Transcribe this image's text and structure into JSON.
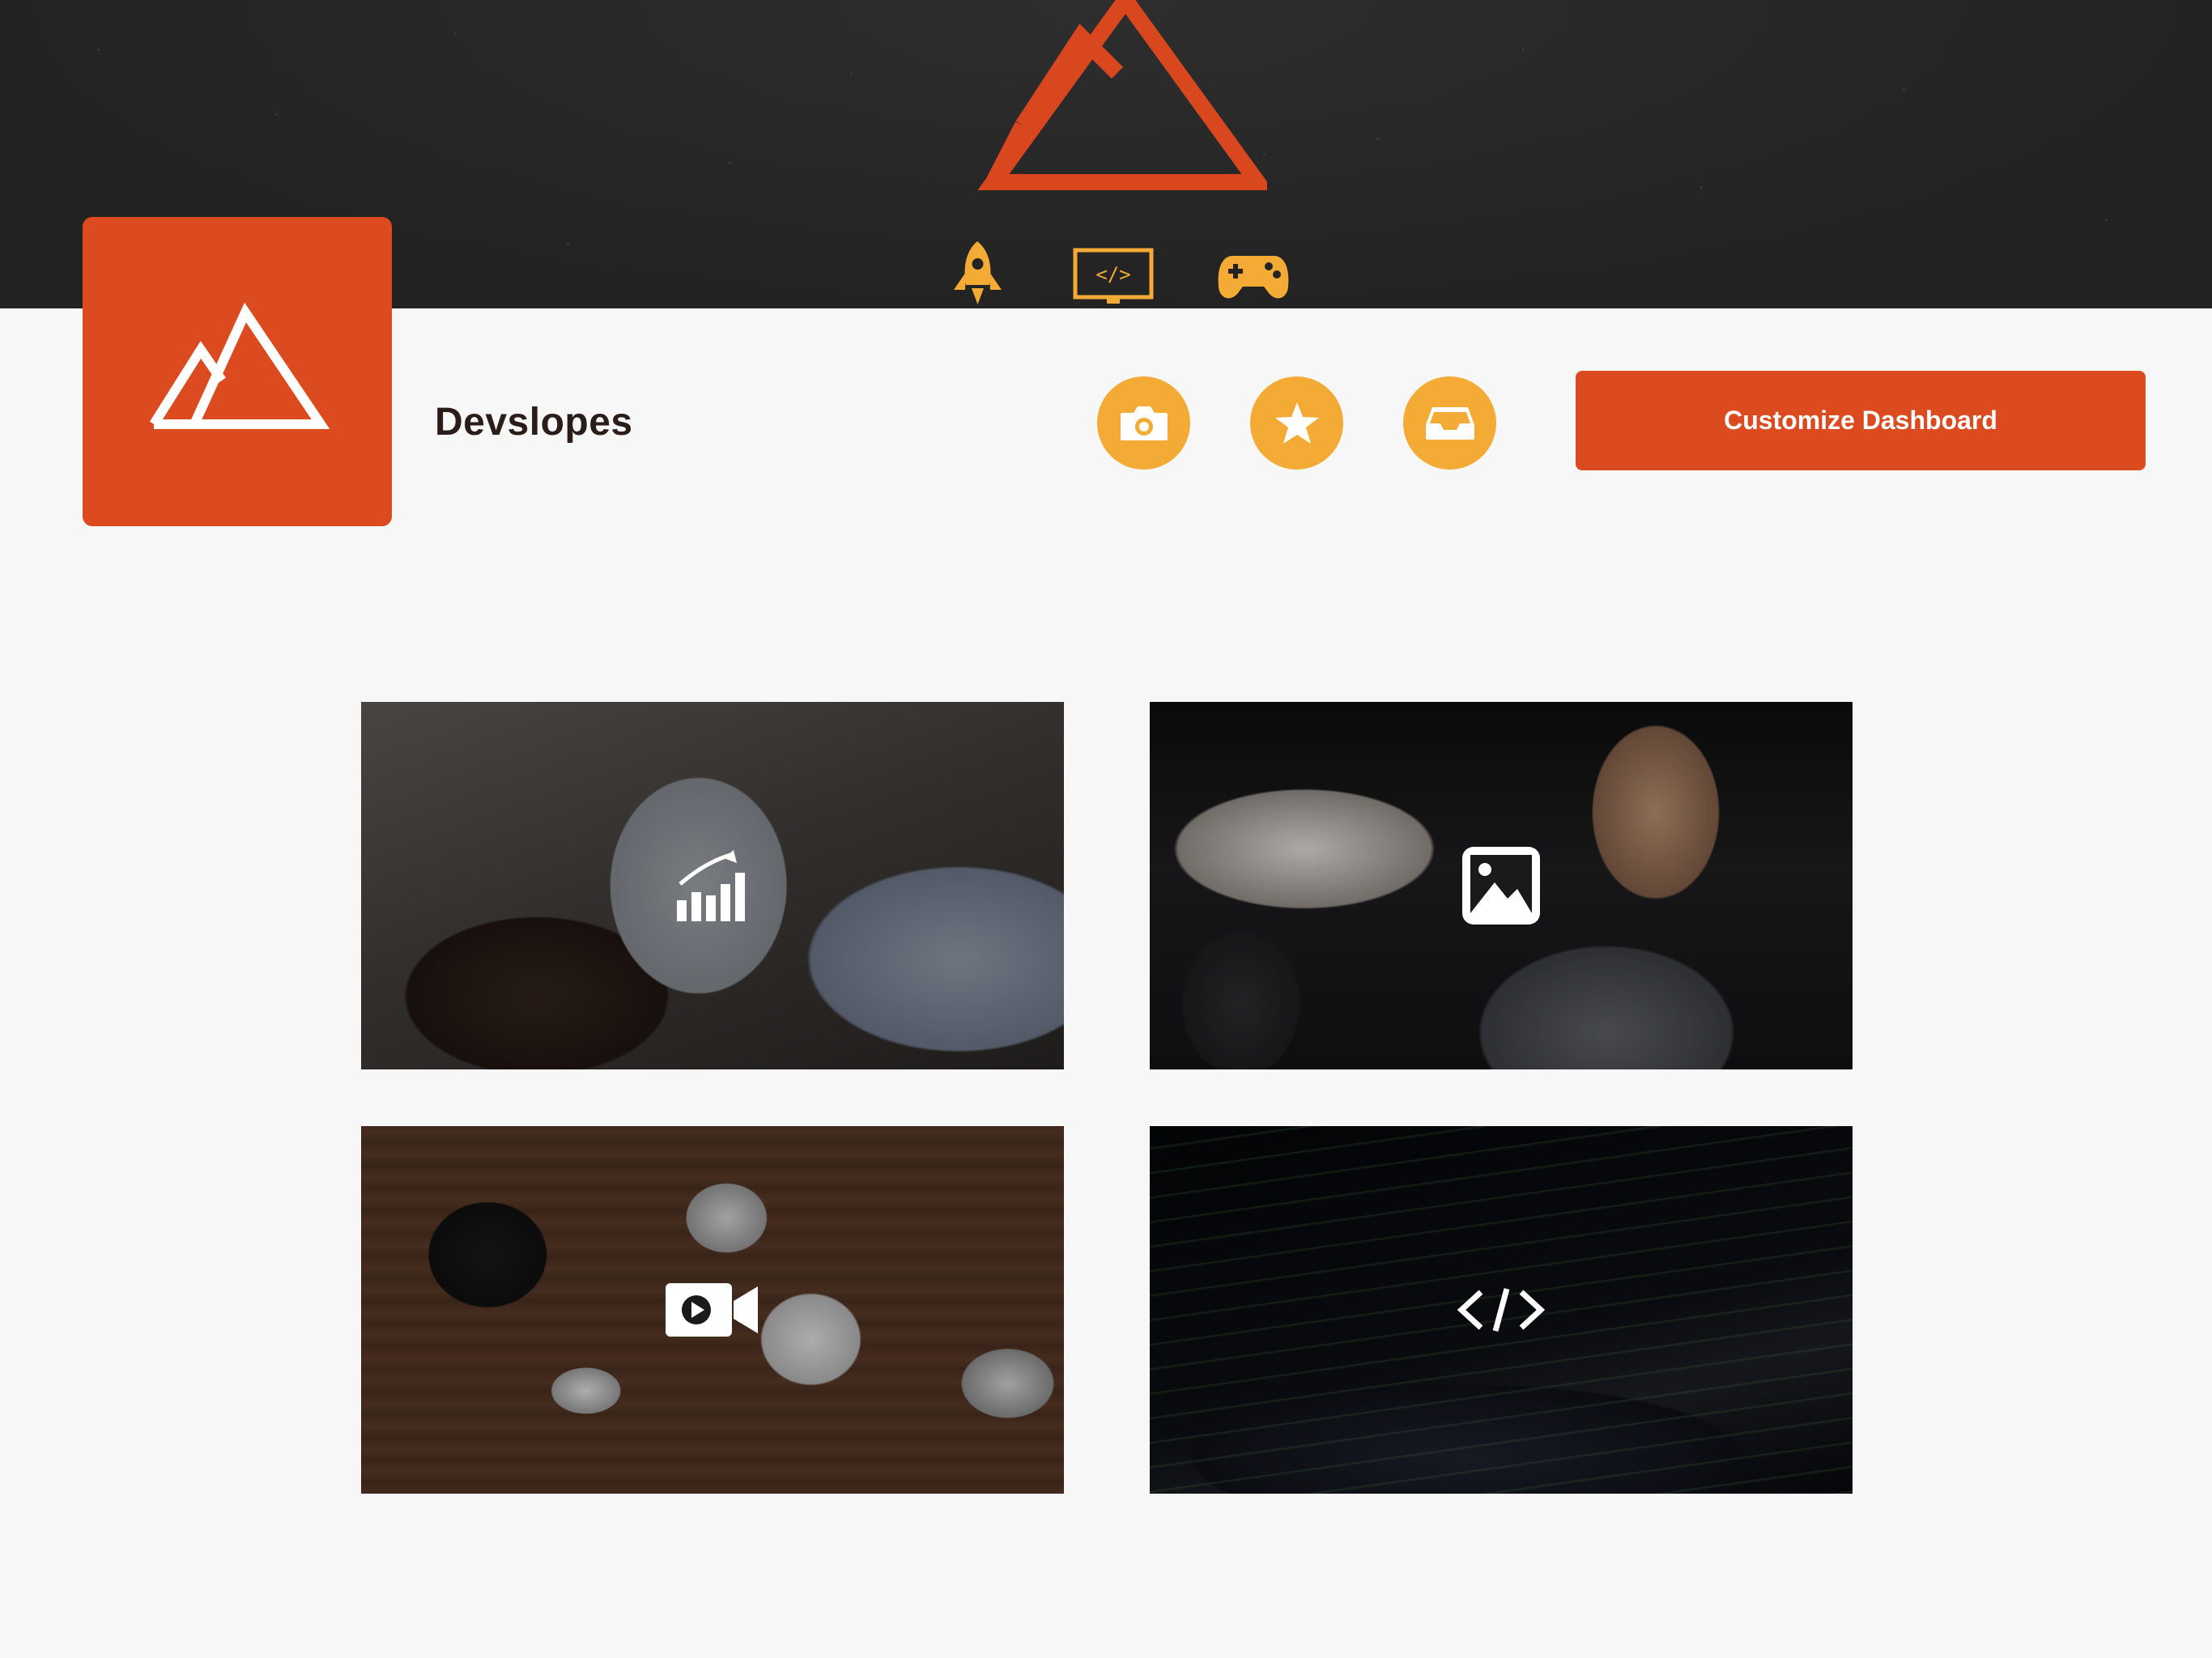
{
  "profile": {
    "name": "Devslopes"
  },
  "actions": {
    "customize_label": "Customize Dashboard"
  },
  "nav": {
    "items": [
      {
        "icon": "rocket-icon"
      },
      {
        "icon": "code-monitor-icon"
      },
      {
        "icon": "gamepad-icon"
      }
    ]
  },
  "quick_actions": [
    {
      "icon": "camera-icon"
    },
    {
      "icon": "star-icon"
    },
    {
      "icon": "inbox-icon"
    }
  ],
  "cards": [
    {
      "icon": "chart-icon",
      "scene": "tablet-analytics-photo"
    },
    {
      "icon": "image-icon",
      "scene": "man-thinking-photo"
    },
    {
      "icon": "video-camera-icon",
      "scene": "camera-gear-photo"
    },
    {
      "icon": "code-icon",
      "scene": "laptop-code-photo"
    }
  ],
  "colors": {
    "brand_orange": "#dc4a1f",
    "accent_yellow": "#f4ab35",
    "header_dark": "#232323",
    "page_bg": "#f7f7f7"
  }
}
